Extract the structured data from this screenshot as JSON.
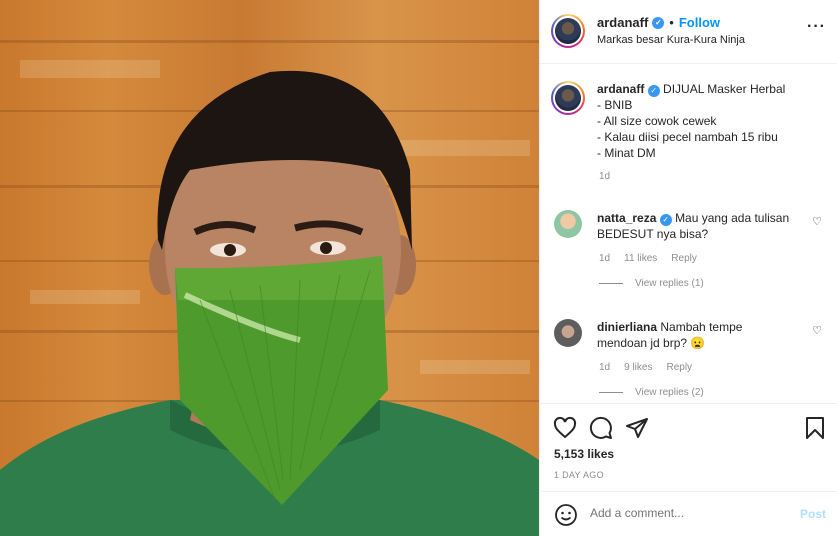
{
  "post": {
    "username": "ardanaff",
    "follow_label": "Follow",
    "location": "Markas besar Kura-Kura Ninja",
    "separator": "•"
  },
  "caption": {
    "username": "ardanaff",
    "lines": [
      "DIJUAL Masker Herbal",
      "- BNIB",
      "- All size cowok cewek",
      "- Kalau diisi pecel nambah 15 ribu",
      "- Minat DM"
    ],
    "time": "1d"
  },
  "comments": [
    {
      "username": "natta_reza",
      "text": "Mau yang ada tulisan BEDESUT nya bisa?",
      "time": "1d",
      "likes": "11 likes",
      "reply_label": "Reply",
      "view_replies": "View replies (1)"
    },
    {
      "username": "dinierliana",
      "text": "Nambah tempe mendoan jd brp? 😦",
      "time": "1d",
      "likes": "9 likes",
      "reply_label": "Reply",
      "view_replies": "View replies (2)"
    }
  ],
  "stats": {
    "likes": "5,153 likes",
    "posted": "1 DAY AGO"
  },
  "composer": {
    "placeholder": "Add a comment...",
    "post_label": "Post"
  },
  "colors": {
    "accent": "#0095f6",
    "verified": "#3897f0",
    "muted": "#8e8e8e",
    "post_disabled": "#b2dffc"
  },
  "icons": [
    "verified-icon",
    "more-icon",
    "heart-icon",
    "comment-icon",
    "share-icon",
    "bookmark-icon",
    "emoji-icon"
  ]
}
